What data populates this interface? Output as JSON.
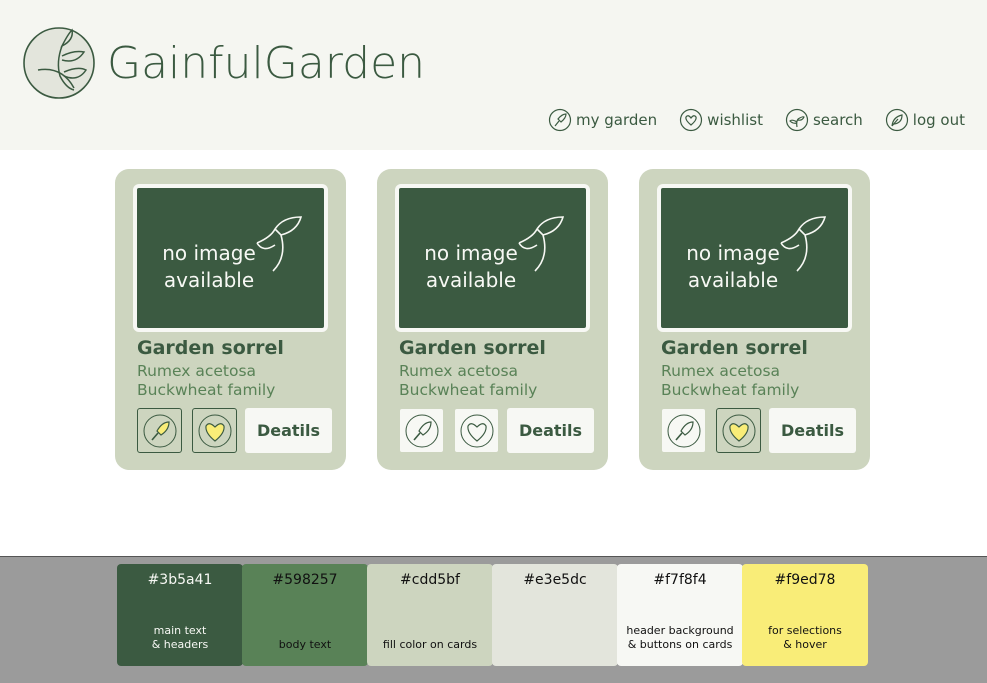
{
  "header": {
    "brand": "GainfulGarden",
    "nav": [
      {
        "label": "my garden",
        "icon": "trowel-icon"
      },
      {
        "label": "wishlist",
        "icon": "heart-icon"
      },
      {
        "label": "search",
        "icon": "sprout-icon"
      },
      {
        "label": "log out",
        "icon": "leaf-icon"
      }
    ]
  },
  "cards": [
    {
      "image_text": "no image\navailable",
      "title": "Garden sorrel",
      "scientific": "Rumex acetosa",
      "family": "Buckwheat family",
      "details_label": "Deatils",
      "in_garden": true,
      "in_wishlist": true
    },
    {
      "image_text": "no image\navailable",
      "title": "Garden sorrel",
      "scientific": "Rumex acetosa",
      "family": "Buckwheat family",
      "details_label": "Deatils",
      "in_garden": false,
      "in_wishlist": false
    },
    {
      "image_text": "no image\navailable",
      "title": "Garden sorrel",
      "scientific": "Rumex acetosa",
      "family": "Buckwheat family",
      "details_label": "Deatils",
      "in_garden": false,
      "in_wishlist": true
    }
  ],
  "palette": [
    {
      "hex": "#3b5a41",
      "label": "main text\n& headers",
      "text_color": "#f7f8f4"
    },
    {
      "hex": "#598257",
      "label": "body text",
      "text_color": "#111111"
    },
    {
      "hex": "#cdd5bf",
      "label": "fill color on cards",
      "text_color": "#111111"
    },
    {
      "hex": "#e3e5dc",
      "label": "",
      "text_color": "#111111"
    },
    {
      "hex": "#f7f8f4",
      "label": "header background\n& buttons on cards",
      "text_color": "#111111"
    },
    {
      "hex": "#f9ed78",
      "label": "for selections\n& hover",
      "text_color": "#111111"
    }
  ],
  "colors": {
    "main": "#3b5a41",
    "body": "#598257",
    "card_fill": "#cdd5bf",
    "light": "#e3e5dc",
    "header_bg": "#f7f8f4",
    "selection": "#f9ed78"
  }
}
